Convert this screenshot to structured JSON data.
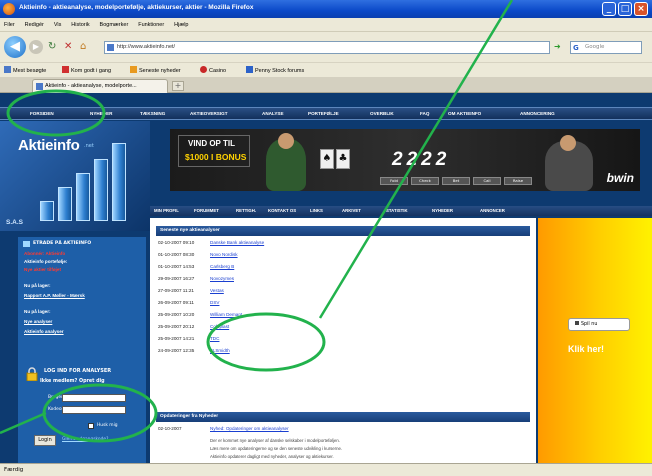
{
  "window": {
    "title": "Aktieinfo - aktieanalyse, modelportefølje, aktiekurser, aktier - Mozilla Firefox",
    "controls": [
      "_",
      "□",
      "×"
    ]
  },
  "menu": [
    "Filer",
    "Redigér",
    "Vis",
    "Historik",
    "Bogmærker",
    "Funktioner",
    "Hjælp"
  ],
  "navigation": {
    "url": "http://www.aktieinfo.net/",
    "search_placeholder": "Google"
  },
  "bookmarks": [
    "Mest besøgte",
    "Kom godt i gang",
    "Seneste nyheder",
    "Casino",
    "Penny Stock forums"
  ],
  "tabs": [
    {
      "label": "Aktieinfo - aktieanalyse, modelporte..."
    }
  ],
  "site": {
    "top_nav": [
      "FORSIDEN",
      "NYHEDER",
      "TÆKSNING",
      "AKTIEOVERSIGT",
      "ANALYSE",
      "PORTEFØLJE",
      "OVERBLIK",
      "FAQ",
      "OM AKTIEINFO",
      "ANNONCERING"
    ],
    "logo": {
      "name": "Aktieinfo",
      "suffix": ".net",
      "tag": "S.A.S"
    },
    "banner": {
      "headline": "VIND OP TIL",
      "bonus": "$1000 I BONUS",
      "digits": "2222",
      "brand": "bwin",
      "buttons": [
        "Fold",
        "Check",
        "Bet",
        "Call",
        "Raise"
      ]
    },
    "sub_nav": [
      "MIN PROFIL",
      "FORUMMET",
      "RETTIGH.",
      "KONTAKT OS",
      "LINKS",
      "ARKIVET",
      "STATISTIK",
      "NYHEDER",
      "ANNONCER"
    ],
    "sidebar": {
      "heading": "ETRADE PÅ AKTIEINFO",
      "lines": [
        {
          "text": "Abonnér: Aktieinfo",
          "style": "red"
        },
        {
          "text": "Aktieinfo portefølje:",
          "style": "wht"
        },
        {
          "text": "Nye aktier tilføjet",
          "style": "red"
        },
        {
          "text": "Nu på lager:",
          "style": "wht"
        },
        {
          "text": "Rapport A.P. Møller - Mærsk",
          "style": "lnk"
        },
        {
          "text": "Nu på lager:",
          "style": "wht"
        },
        {
          "text": "Nye analyser",
          "style": "lnk"
        },
        {
          "text": "Aktieinfo analyser",
          "style": "lnk"
        }
      ]
    },
    "login": {
      "title": "LOG IND FOR ANALYSER",
      "subtitle": "Ikke medlem? Opret dig",
      "user_label": "Bruger",
      "password_label": "Kodeord",
      "remember_label": "Husk mig",
      "button_label": "Login",
      "forgot_label": "Glemt adgangskode?"
    },
    "news": {
      "heading": "Seneste nye aktieanalyser",
      "items": [
        {
          "date": "02-10-2007 09:10",
          "title": "Danske Bank aktieanalyse"
        },
        {
          "date": "01-10-2007 08:30",
          "title": "Novo Nordisk"
        },
        {
          "date": "01-10-2007 14:53",
          "title": "Carlsberg B"
        },
        {
          "date": "29-09-2007 16:27",
          "title": "Novozymes"
        },
        {
          "date": "27-09-2007 11:21",
          "title": "Vestas"
        },
        {
          "date": "26-09-2007 09:11",
          "title": "DSV"
        },
        {
          "date": "25-09-2007 10:20",
          "title": "William Demant"
        },
        {
          "date": "25-09-2007 20:12",
          "title": "Coloplast"
        },
        {
          "date": "25-09-2007 14:21",
          "title": "TDC"
        },
        {
          "date": "24-09-2007 12:35",
          "title": "FLSmidth"
        }
      ]
    },
    "updates": {
      "heading": "Opdateringer fra Nyheder",
      "date": "02-10-2007",
      "title": "Nyhed: Opdateringer om aktieanalyser",
      "lines": [
        "Der er kommet nye analyser af danske selskaber i modelporteføljen.",
        "Læs mere om opdateringerne og se den seneste udvikling i kurserne.",
        "Aktieinfo opdaterer dagligt med nyheder, analyser og aktiekurser."
      ]
    },
    "ad": {
      "button_label": "Spil nu",
      "cta": "Klik her!"
    }
  },
  "status": "Færdig",
  "annotations": {
    "color": "#22b24c"
  }
}
